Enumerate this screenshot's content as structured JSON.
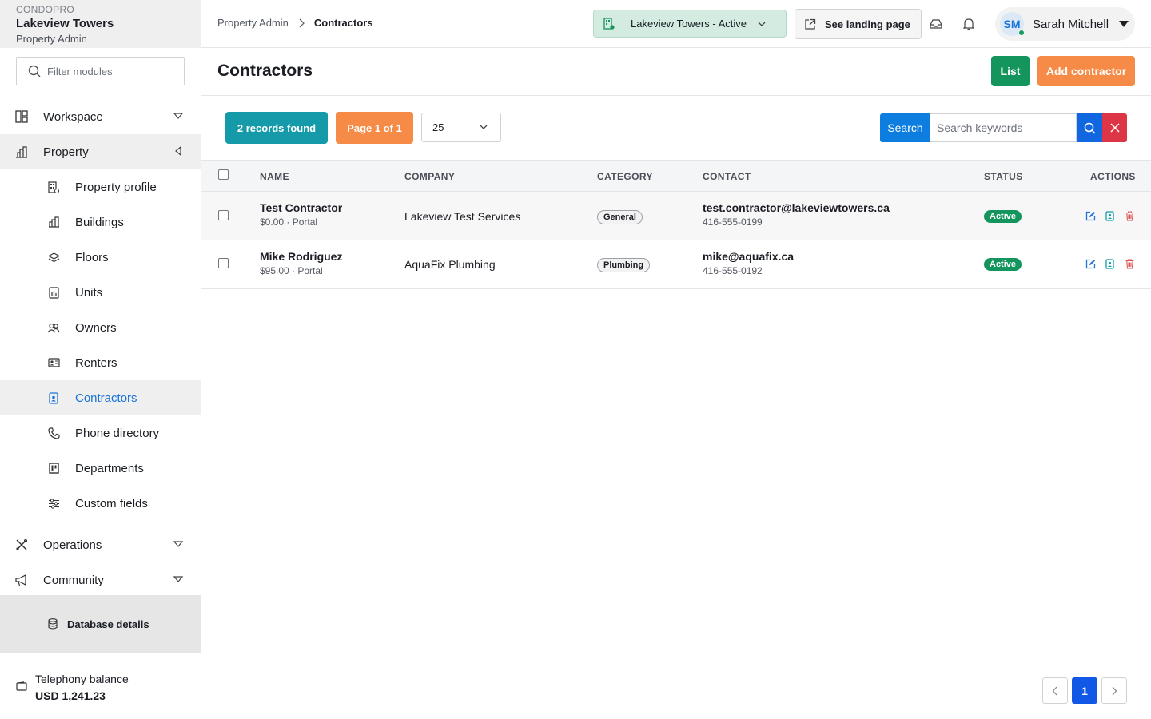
{
  "brand": {
    "app": "CONDOPRO",
    "property": "Lakeview Towers",
    "role": "Property Admin"
  },
  "filter": {
    "placeholder": "Filter modules"
  },
  "nav": {
    "sections": [
      {
        "label": "Workspace",
        "icon": "layout-icon"
      },
      {
        "label": "Property",
        "icon": "building-chart-icon"
      },
      {
        "label": "Operations",
        "icon": "tools-icon"
      },
      {
        "label": "Community",
        "icon": "megaphone-icon"
      }
    ],
    "property_items": [
      {
        "label": "Property profile",
        "icon": "building-icon"
      },
      {
        "label": "Buildings",
        "icon": "buildings-icon"
      },
      {
        "label": "Floors",
        "icon": "layers-icon"
      },
      {
        "label": "Units",
        "icon": "unit-icon"
      },
      {
        "label": "Owners",
        "icon": "people-icon"
      },
      {
        "label": "Renters",
        "icon": "id-card-icon"
      },
      {
        "label": "Contractors",
        "icon": "badge-icon"
      },
      {
        "label": "Phone directory",
        "icon": "phone-icon"
      },
      {
        "label": "Departments",
        "icon": "department-icon"
      },
      {
        "label": "Custom fields",
        "icon": "sliders-icon"
      }
    ],
    "db_details": "Database details"
  },
  "balance": {
    "label": "Telephony balance",
    "value": "USD 1,241.23"
  },
  "topbar": {
    "breadcrumb": [
      "Property Admin",
      "Contractors"
    ],
    "property_selector": "Lakeview Towers - Active",
    "landing_button": "See landing page",
    "user": {
      "initials": "SM",
      "name": "Sarah Mitchell"
    }
  },
  "page": {
    "title": "Contractors",
    "list_button": "List",
    "add_button": "Add contractor"
  },
  "toolbar": {
    "records": "2 records found",
    "page": "Page 1 of 1",
    "per_page": "25",
    "search_label": "Search",
    "search_placeholder": "Search keywords"
  },
  "table": {
    "columns": [
      "NAME",
      "COMPANY",
      "CATEGORY",
      "CONTACT",
      "STATUS",
      "ACTIONS"
    ],
    "rows": [
      {
        "name": "Test Contractor",
        "sub": "$0.00 · Portal",
        "company": "Lakeview Test Services",
        "category": "General",
        "email": "test.contractor@lakeviewtowers.ca",
        "phone": "416-555-0199",
        "status": "Active"
      },
      {
        "name": "Mike Rodriguez",
        "sub": "$95.00 · Portal",
        "company": "AquaFix Plumbing",
        "category": "Plumbing",
        "email": "mike@aquafix.ca",
        "phone": "416-555-0192",
        "status": "Active"
      }
    ]
  },
  "pagination": {
    "current": "1"
  },
  "colors": {
    "accent_blue": "#1a73d9",
    "green": "#13955d",
    "orange": "#f58b46",
    "teal": "#149aa9",
    "red": "#dc3545"
  }
}
